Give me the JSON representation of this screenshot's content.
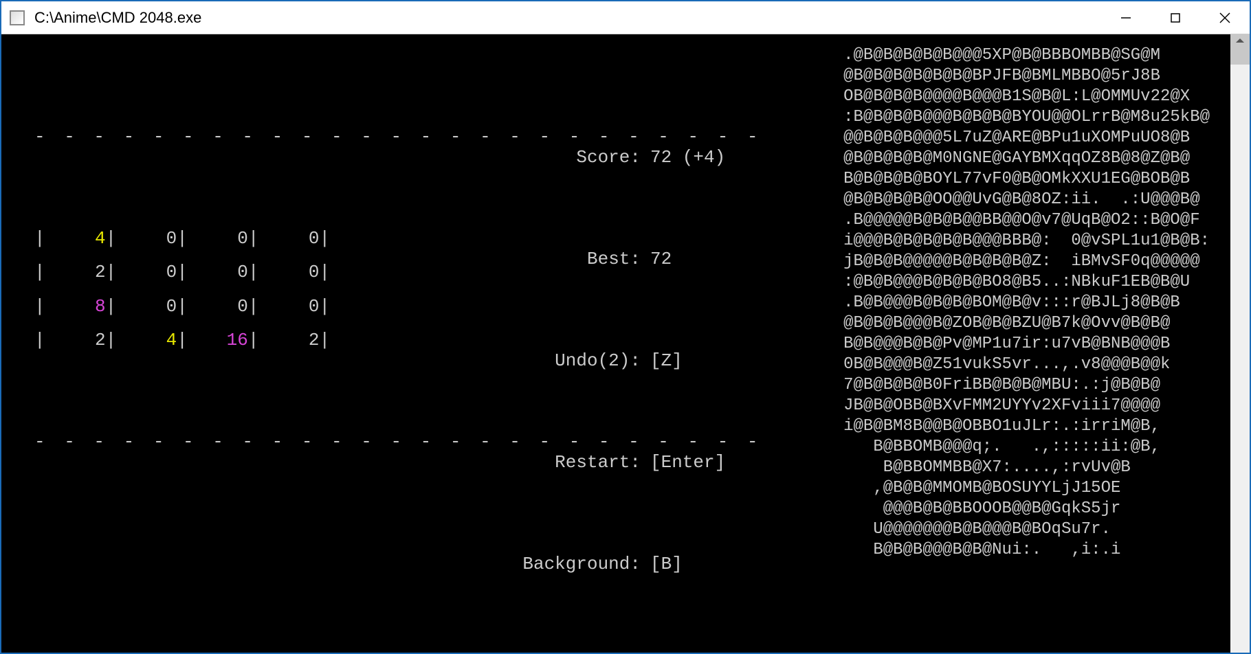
{
  "window": {
    "title": "C:\\Anime\\CMD 2048.exe"
  },
  "board": {
    "divider": "- - - - - - - - - - - - - - - - - - - - - - - - -",
    "rows": [
      [
        {
          "v": "4",
          "c": "yellow"
        },
        {
          "v": "0",
          "c": "gray"
        },
        {
          "v": "0",
          "c": "gray"
        },
        {
          "v": "0",
          "c": "gray"
        }
      ],
      [
        {
          "v": "2",
          "c": "gray"
        },
        {
          "v": "0",
          "c": "gray"
        },
        {
          "v": "0",
          "c": "gray"
        },
        {
          "v": "0",
          "c": "gray"
        }
      ],
      [
        {
          "v": "8",
          "c": "magenta"
        },
        {
          "v": "0",
          "c": "gray"
        },
        {
          "v": "0",
          "c": "gray"
        },
        {
          "v": "0",
          "c": "gray"
        }
      ],
      [
        {
          "v": "2",
          "c": "gray"
        },
        {
          "v": "4",
          "c": "yellow"
        },
        {
          "v": "16",
          "c": "magenta"
        },
        {
          "v": "2",
          "c": "gray"
        }
      ]
    ]
  },
  "info": {
    "score_label": "Score:",
    "score_value": "72 (+4)",
    "best_label": "Best:",
    "best_value": "72",
    "undo_label": "Undo(2):",
    "undo_value": "[Z]",
    "restart_label": "Restart:",
    "restart_value": "[Enter]",
    "background_label": "Background:",
    "background_value": "[B]"
  },
  "ascii_art": ".@B@B@B@B@B@@@5XP@B@BBBOMBB@SG@M\n@B@B@B@B@B@B@BPJFB@BMLMBBO@5rJ8B\nOB@B@B@B@@@@B@@@B1S@B@L:L@OMMUv22@X\n:B@B@B@B@@@B@B@B@BYOU@@OLrrB@M8u25kB@\n@@B@B@B@@@5L7uZ@ARE@BPu1uXOMPuUO8@B\n@B@B@B@B@M0NGNE@GAYBMXqqOZ8B@8@Z@B@\nB@B@B@B@BOYL77vF0@B@OMkXXU1EG@BOB@B\n@B@B@B@B@OO@@UvG@B@8OZ:ii.  .:U@@@B@\n.B@@@@@B@B@B@@BB@@O@v7@UqB@O2::B@O@F\ni@@@B@B@B@B@B@@@BBB@:  0@vSPL1u1@B@B:\njB@B@B@@@@@B@B@B@B@Z:  iBMvSF0q@@@@@\n:@B@B@@@B@B@B@BO8@B5..:NBkuF1EB@B@U\n.B@B@@@B@B@B@BOM@B@v:::r@BJLj8@B@B\n@B@B@B@@@B@ZOB@B@BZU@B7k@Ovv@B@B@\nB@B@@@B@B@Pv@MP1u7ir:u7vB@BNB@@@B\n0B@B@@@B@Z51vukS5vr...,.v8@@@B@@k\n7@B@B@B@B0FriBB@B@B@MBU:.:j@B@B@\nJB@B@OBB@BXvFMM2UYYv2XFviii7@@@@\ni@B@BM8B@@B@OBBO1uJLr:.:irriM@B,\n   B@BBOMB@@@q;.   .,:::::ii:@B,\n    B@BBOMMBB@X7:....,:rvUv@B\n   ,@B@B@MMOMB@BOSUYYLjJ15OE\n    @@@B@B@BBOOOB@@B@GqkS5jr\n   U@@@@@@@B@B@@@B@BOqSu7r.\n   B@B@B@@@B@B@Nui:.   ,i:.i"
}
